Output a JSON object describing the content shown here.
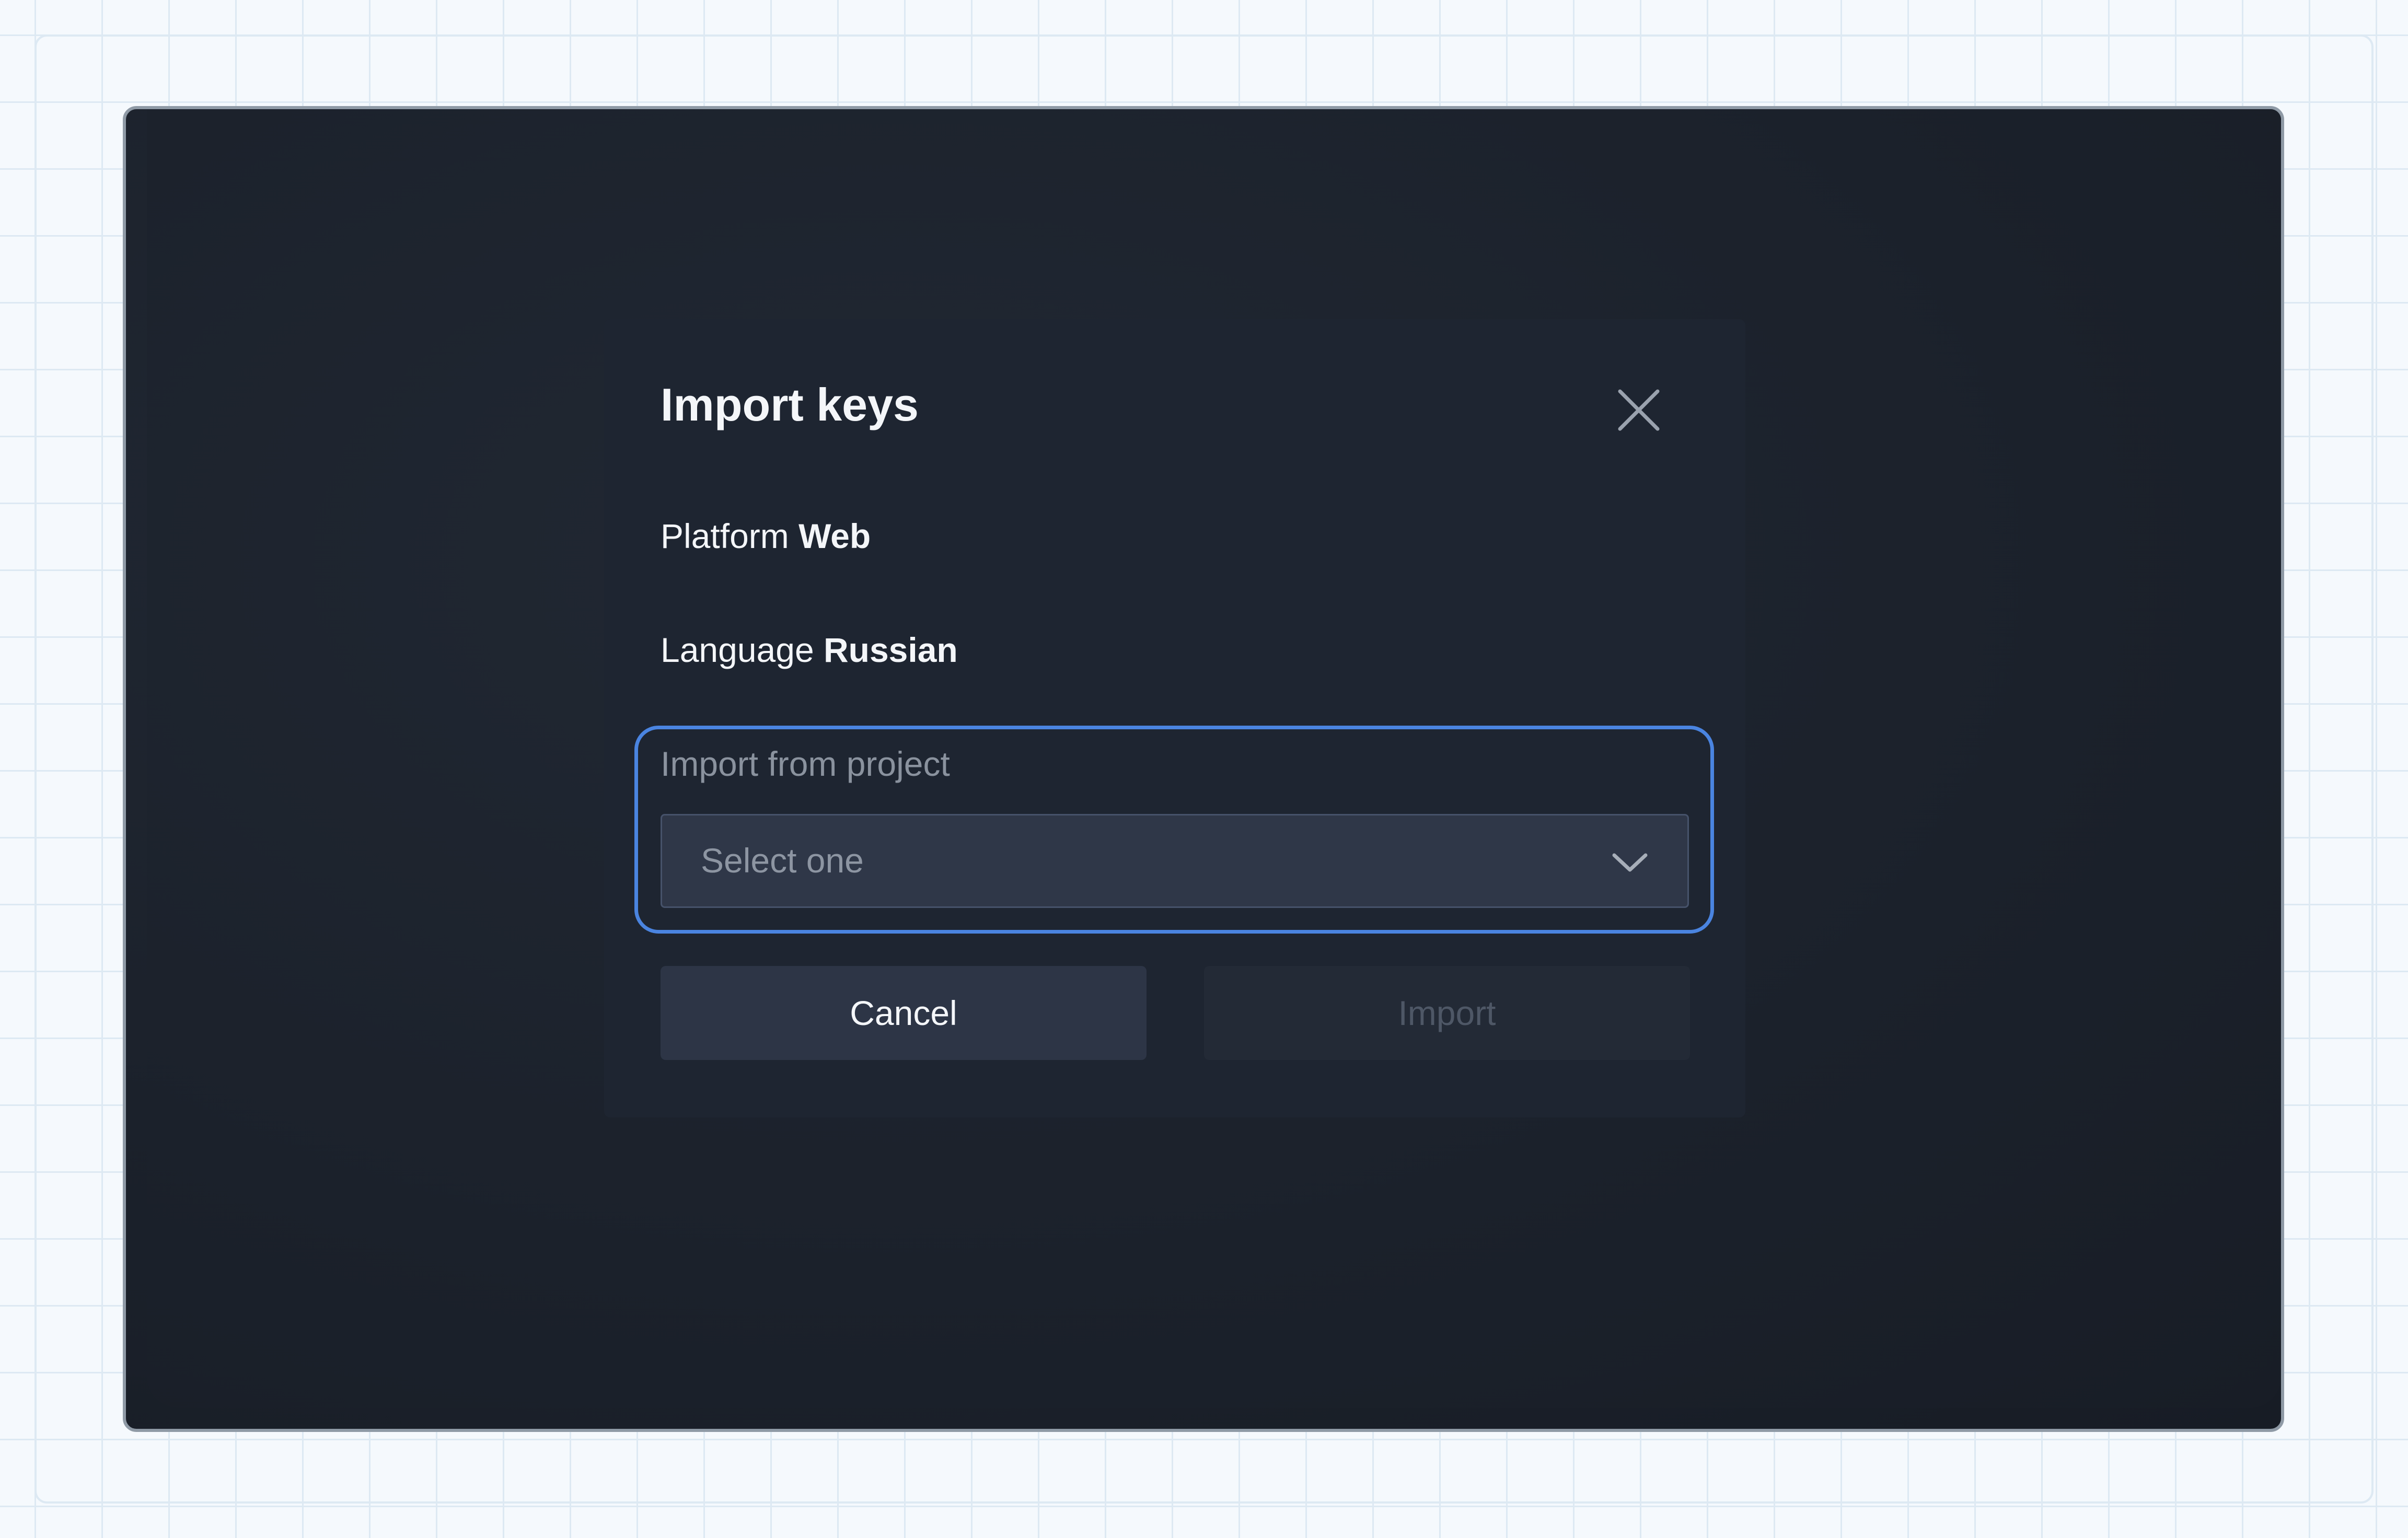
{
  "dialog": {
    "title": "Import keys",
    "platform_label": "Platform",
    "platform_value": "Web",
    "language_label": "Language",
    "language_value": "Russian",
    "import_from_label": "Import from project",
    "select_placeholder": "Select one",
    "cancel_label": "Cancel",
    "import_label": "Import"
  },
  "icons": {
    "close": "close-icon",
    "dropdown": "chevron-down-icon"
  },
  "colors": {
    "accent": "#4a84e0",
    "dialog_background": "#1e2531",
    "text_primary": "#f4f6f9",
    "text_muted": "#8a929e"
  }
}
